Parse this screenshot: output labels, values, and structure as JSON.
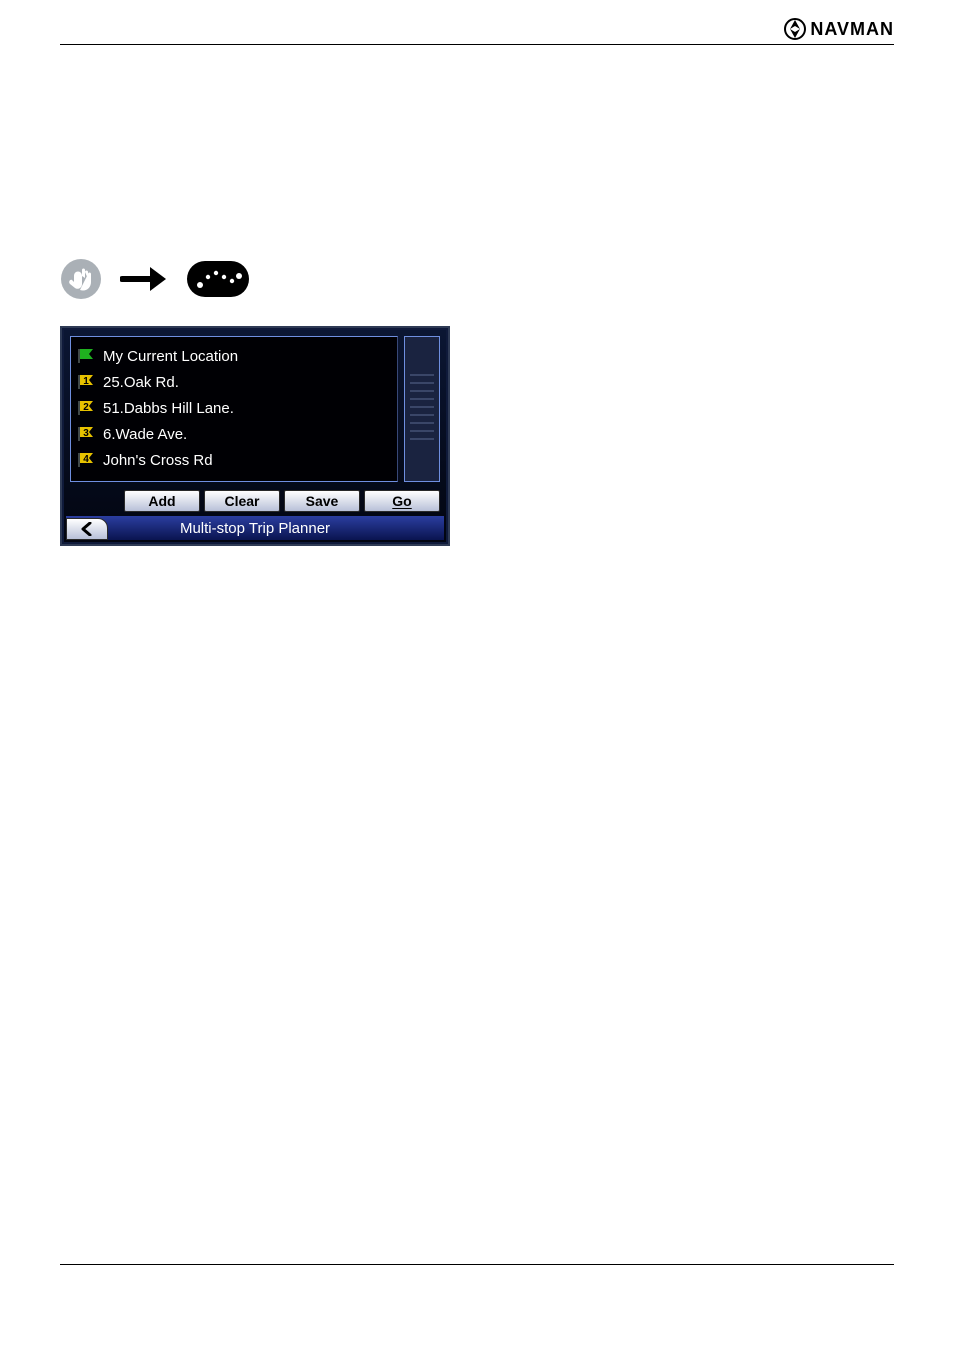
{
  "brand": {
    "name": "NAVMAN"
  },
  "device": {
    "list": [
      {
        "label": "My Current Location",
        "flag_color": "green",
        "num": ""
      },
      {
        "label": "25.Oak Rd.",
        "flag_color": "yellow",
        "num": "1"
      },
      {
        "label": "51.Dabbs Hill Lane.",
        "flag_color": "yellow",
        "num": "2"
      },
      {
        "label": "6.Wade Ave.",
        "flag_color": "yellow",
        "num": "3"
      },
      {
        "label": "John's Cross Rd",
        "flag_color": "yellow",
        "num": "4"
      }
    ],
    "buttons": {
      "add": "Add",
      "clear": "Clear",
      "save": "Save",
      "go": "Go"
    },
    "titlebar": "Multi-stop Trip Planner"
  }
}
